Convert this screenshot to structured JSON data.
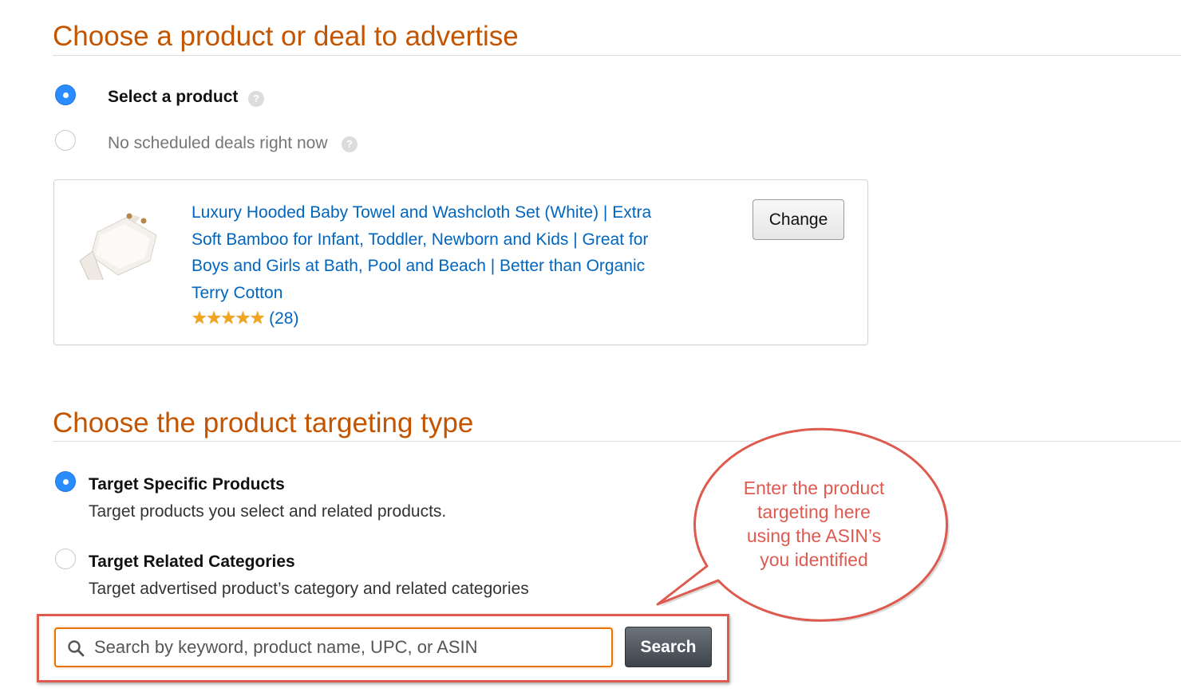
{
  "section1": {
    "title": "Choose a product or deal to advertise",
    "options": [
      {
        "label": "Select a product",
        "checked": true,
        "help_icon": "question-icon"
      },
      {
        "label": "No scheduled deals right now",
        "checked": false,
        "help_icon": "question-icon"
      }
    ],
    "product": {
      "title": "Luxury Hooded Baby Towel and Washcloth Set (White) | Extra Soft Bamboo for Infant, Toddler, Newborn and Kids | Great for Boys and Girls at Bath, Pool and Beach | Better than Organic Terry Cotton",
      "rating": 5,
      "stars": "★★★★★",
      "review_count": "(28)",
      "change_label": "Change"
    }
  },
  "section2": {
    "title": "Choose the product targeting type",
    "options": [
      {
        "label": "Target Specific Products",
        "description": "Target products you select and related products.",
        "checked": true
      },
      {
        "label": "Target Related Categories",
        "description": "Target advertised product’s category and related categories",
        "checked": false
      }
    ],
    "search": {
      "placeholder": "Search by keyword, product name, UPC, or ASIN",
      "value": "",
      "button_label": "Search",
      "icon": "search-icon"
    }
  },
  "callout": {
    "lines": [
      "Enter the product",
      "targeting here",
      "using the ASIN’s",
      "you identified"
    ]
  },
  "colors": {
    "heading": "#c45500",
    "link": "#0066c0",
    "radio_checked": "#2b8cff",
    "annotation": "#de5a4f",
    "search_focus": "#e77600"
  }
}
